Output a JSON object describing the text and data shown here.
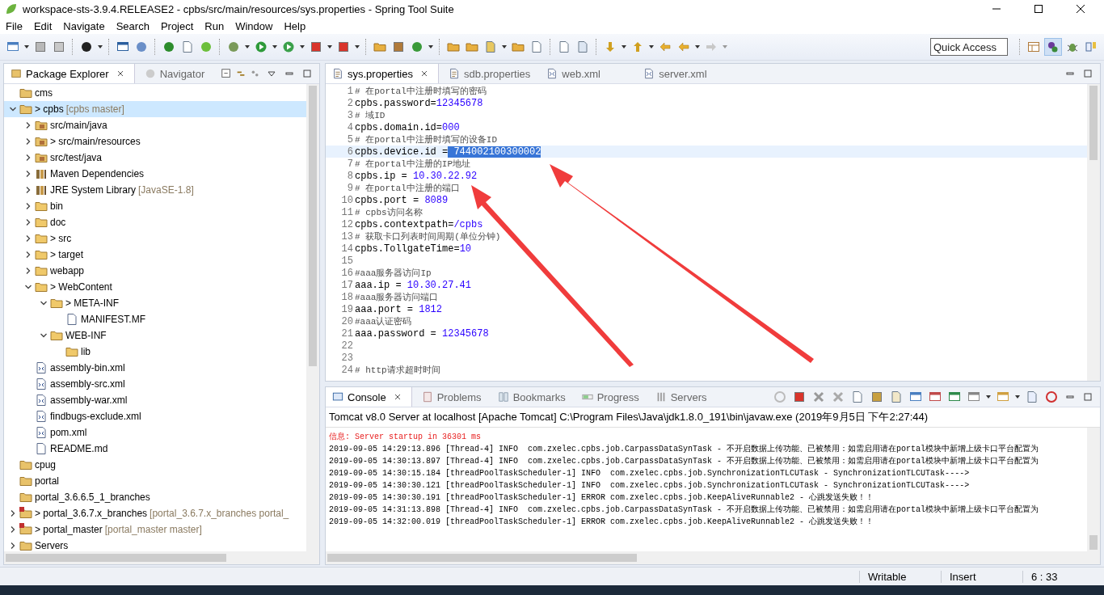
{
  "window": {
    "title": "workspace-sts-3.9.4.RELEASE2 - cpbs/src/main/resources/sys.properties - Spring Tool Suite"
  },
  "menu": [
    "File",
    "Edit",
    "Navigate",
    "Search",
    "Project",
    "Run",
    "Window",
    "Help"
  ],
  "quick_access": {
    "placeholder": "Quick Access"
  },
  "explorer": {
    "tabs": [
      {
        "label": "Package Explorer",
        "selected": true
      },
      {
        "label": "Navigator",
        "selected": false
      }
    ],
    "tree": [
      {
        "label": "cms",
        "kind": "project",
        "selected": false
      },
      {
        "label": "> cpbs",
        "decoration": "[cpbs master]",
        "kind": "project",
        "expanded": true,
        "selected": true,
        "children": [
          {
            "label": "src/main/java",
            "kind": "source",
            "expanded": false,
            "selected": false
          },
          {
            "label": "> src/main/resources",
            "kind": "source",
            "expanded": false,
            "selected": false
          },
          {
            "label": "src/test/java",
            "kind": "source",
            "expanded": false,
            "selected": false
          },
          {
            "label": "Maven Dependencies",
            "kind": "library",
            "expanded": false,
            "selected": false
          },
          {
            "label": "JRE System Library",
            "decoration": "[JavaSE-1.8]",
            "kind": "library",
            "expanded": false,
            "selected": false
          },
          {
            "label": "bin",
            "kind": "folder",
            "expanded": false,
            "selected": false
          },
          {
            "label": "doc",
            "kind": "folder",
            "expanded": false,
            "selected": false
          },
          {
            "label": "> src",
            "kind": "folder",
            "expanded": false,
            "selected": false
          },
          {
            "label": "> target",
            "kind": "folder",
            "expanded": false,
            "selected": false
          },
          {
            "label": "webapp",
            "kind": "folder",
            "expanded": false,
            "selected": false
          },
          {
            "label": "> WebContent",
            "kind": "folder",
            "expanded": true,
            "selected": false,
            "children": [
              {
                "label": "> META-INF",
                "kind": "folder",
                "expanded": true,
                "selected": false,
                "children": [
                  {
                    "label": "MANIFEST.MF",
                    "kind": "file",
                    "selected": false
                  }
                ]
              },
              {
                "label": "WEB-INF",
                "kind": "folder",
                "expanded": true,
                "selected": false,
                "children": [
                  {
                    "label": "lib",
                    "kind": "folder",
                    "selected": false
                  }
                ]
              }
            ]
          },
          {
            "label": "assembly-bin.xml",
            "kind": "xml",
            "selected": false
          },
          {
            "label": "assembly-src.xml",
            "kind": "xml",
            "selected": false
          },
          {
            "label": "assembly-war.xml",
            "kind": "xml",
            "selected": false
          },
          {
            "label": "findbugs-exclude.xml",
            "kind": "xml",
            "selected": false
          },
          {
            "label": "pom.xml",
            "kind": "xml",
            "selected": false
          },
          {
            "label": "README.md",
            "kind": "file",
            "selected": false
          }
        ]
      },
      {
        "label": "cpug",
        "kind": "project",
        "selected": false
      },
      {
        "label": "portal",
        "kind": "project",
        "selected": false
      },
      {
        "label": "portal_3.6.6.5_1_branches",
        "kind": "project",
        "selected": false
      },
      {
        "label": "> portal_3.6.7.x_branches",
        "decoration": "[portal_3.6.7.x_branches portal_",
        "kind": "maven",
        "expanded": false,
        "selected": false
      },
      {
        "label": "> portal_master",
        "decoration": "[portal_master master]",
        "kind": "maven",
        "expanded": false,
        "selected": false
      },
      {
        "label": "Servers",
        "kind": "project",
        "expanded": false,
        "selected": false
      }
    ]
  },
  "editor": {
    "tabs": [
      {
        "label": "sys.properties",
        "kind": "properties",
        "selected": true
      },
      {
        "label": "sdb.properties",
        "kind": "properties",
        "selected": false
      },
      {
        "label": "web.xml",
        "kind": "xml",
        "selected": false
      },
      {
        "label": "server.xml",
        "kind": "xml",
        "selected": false
      }
    ],
    "lines": [
      {
        "number": "1",
        "kind": "comment",
        "text": "# 在portal中注册时填写的密码",
        "current": false
      },
      {
        "number": "2",
        "kind": "property",
        "key": "cpbs.password=",
        "value": "12345678",
        "current": false,
        "value_selected": false
      },
      {
        "number": "3",
        "kind": "comment",
        "text": "# 域ID",
        "current": false
      },
      {
        "number": "4",
        "kind": "property",
        "key": "cpbs.domain.id=",
        "value": "000",
        "current": false,
        "value_selected": false
      },
      {
        "number": "5",
        "kind": "comment",
        "text": "# 在portal中注册时填写的设备ID",
        "current": false
      },
      {
        "number": "6",
        "kind": "property",
        "key": "cpbs.device.id =",
        "value": " 744002100300002",
        "current": true,
        "value_selected": true
      },
      {
        "number": "7",
        "kind": "comment",
        "text": "# 在portal中注册的IP地址",
        "current": false
      },
      {
        "number": "8",
        "kind": "property",
        "key": "cpbs.ip = ",
        "value": "10.30.22.92",
        "current": false,
        "value_selected": false
      },
      {
        "number": "9",
        "kind": "comment",
        "text": "# 在portal中注册的端口",
        "current": false
      },
      {
        "number": "10",
        "kind": "property",
        "key": "cpbs.port = ",
        "value": "8089",
        "current": false,
        "value_selected": false
      },
      {
        "number": "11",
        "kind": "comment",
        "text": "# cpbs访问名称",
        "current": false
      },
      {
        "number": "12",
        "kind": "property",
        "key": "cpbs.contextpath=",
        "value": "/cpbs",
        "current": false,
        "value_selected": false
      },
      {
        "number": "13",
        "kind": "comment",
        "text": "# 获取卡口列表时间周期(单位分钟)",
        "current": false
      },
      {
        "number": "14",
        "kind": "property",
        "key": "cpbs.TollgateTime=",
        "value": "10",
        "current": false,
        "value_selected": false
      },
      {
        "number": "15",
        "kind": "blank",
        "current": false
      },
      {
        "number": "16",
        "kind": "comment",
        "text": "#aaa服务器访问Ip",
        "current": false
      },
      {
        "number": "17",
        "kind": "property",
        "key": "aaa.ip = ",
        "value": "10.30.27.41",
        "current": false,
        "value_selected": false
      },
      {
        "number": "18",
        "kind": "comment",
        "text": "#aaa服务器访问端口",
        "current": false
      },
      {
        "number": "19",
        "kind": "property",
        "key": "aaa.port = ",
        "value": "1812",
        "current": false,
        "value_selected": false
      },
      {
        "number": "20",
        "kind": "comment",
        "text": "#aaa认证密码",
        "current": false
      },
      {
        "number": "21",
        "kind": "property",
        "key": "aaa.password = ",
        "value": "12345678",
        "current": false,
        "value_selected": false
      },
      {
        "number": "22",
        "kind": "blank",
        "current": false
      },
      {
        "number": "23",
        "kind": "blank",
        "current": false
      },
      {
        "number": "24",
        "kind": "comment",
        "text": "# http请求超时时间",
        "current": false
      }
    ]
  },
  "console": {
    "tabs": [
      {
        "label": "Console",
        "kind": "console",
        "selected": true
      },
      {
        "label": "Problems",
        "kind": "problems",
        "selected": false
      },
      {
        "label": "Bookmarks",
        "kind": "bookmarks",
        "selected": false
      },
      {
        "label": "Progress",
        "kind": "progress",
        "selected": false
      },
      {
        "label": "Servers",
        "kind": "servers",
        "selected": false
      }
    ],
    "process": "Tomcat v8.0 Server at localhost [Apache Tomcat] C:\\Program Files\\Java\\jdk1.8.0_191\\bin\\javaw.exe (2019年9月5日 下午2:27:44)",
    "lines": [
      {
        "kind": "stderr",
        "text": "信息: Server startup in 36301 ms"
      },
      {
        "kind": "stdout",
        "text": "2019-09-05 14:29:13.896 [Thread-4] INFO  com.zxelec.cpbs.job.CarpassDataSynTask - 不开启数据上传功能、已被禁用：如需启用请在portal模块中新增上级卡口平台配置为"
      },
      {
        "kind": "stdout",
        "text": "2019-09-05 14:30:13.897 [Thread-4] INFO  com.zxelec.cpbs.job.CarpassDataSynTask - 不开启数据上传功能、已被禁用：如需启用请在portal模块中新增上级卡口平台配置为"
      },
      {
        "kind": "stdout",
        "text": "2019-09-05 14:30:15.184 [threadPoolTaskScheduler-1] INFO  com.zxelec.cpbs.job.SynchronizationTLCUTask - SynchronizationTLCUTask---->"
      },
      {
        "kind": "stdout",
        "text": "2019-09-05 14:30:30.121 [threadPoolTaskScheduler-1] INFO  com.zxelec.cpbs.job.SynchronizationTLCUTask - SynchronizationTLCUTask---->"
      },
      {
        "kind": "stdout",
        "text": "2019-09-05 14:30:30.191 [threadPoolTaskScheduler-1] ERROR com.zxelec.cpbs.job.KeepAliveRunnable2 - 心跳发送失败！！"
      },
      {
        "kind": "stdout",
        "text": "2019-09-05 14:31:13.898 [Thread-4] INFO  com.zxelec.cpbs.job.CarpassDataSynTask - 不开启数据上传功能、已被禁用：如需启用请在portal模块中新增上级卡口平台配置为"
      },
      {
        "kind": "stdout",
        "text": "2019-09-05 14:32:00.019 [threadPoolTaskScheduler-1] ERROR com.zxelec.cpbs.job.KeepAliveRunnable2 - 心跳发送失败！！"
      }
    ]
  },
  "status_bar": [
    "Writable",
    "Insert",
    "6 : 33"
  ]
}
